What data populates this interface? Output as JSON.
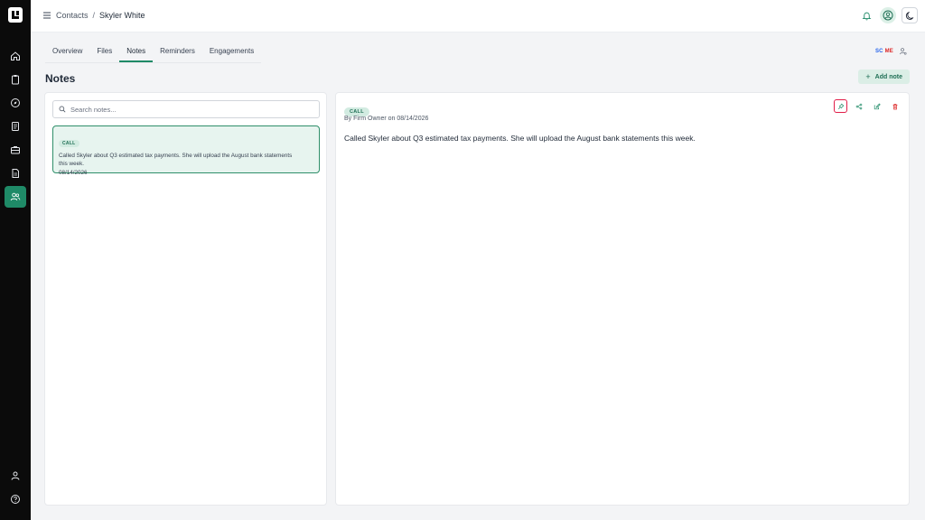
{
  "topbar": {
    "breadcrumb": [
      "Contacts",
      "/",
      "Skyler White"
    ],
    "icons": [
      "menu-icon",
      "bell-icon",
      "user-circle-icon",
      "moon-icon"
    ]
  },
  "sidebar": {
    "items": [
      {
        "icon": "home-icon"
      },
      {
        "icon": "clipboard-icon"
      },
      {
        "icon": "compass-icon"
      },
      {
        "icon": "document-list-icon"
      },
      {
        "icon": "briefcase-icon"
      },
      {
        "icon": "file-text-icon"
      },
      {
        "icon": "users-icon",
        "active": true
      }
    ],
    "bottom": [
      {
        "icon": "person-icon"
      },
      {
        "icon": "help-icon"
      }
    ]
  },
  "tabs": [
    "Overview",
    "Files",
    "Notes",
    "Reminders",
    "Engagements"
  ],
  "active_tab": "Notes",
  "tab_badge": {
    "part1": "SC",
    "part2": "ME"
  },
  "page_title": "Notes",
  "add_note_label": "Add note",
  "search": {
    "placeholder": "Search notes...",
    "value": ""
  },
  "notes_list": [
    {
      "tag": "CALL",
      "text": "Called Skyler about Q3 estimated tax payments. She will upload the August bank statements this week.",
      "date": "08/14/2026"
    }
  ],
  "detail": {
    "tag": "CALL",
    "author_line": "By Firm Owner on 08/14/2026",
    "body": "Called Skyler about Q3 estimated tax payments. She will upload the August bank statements this week.",
    "actions": [
      "pin-icon",
      "share-icon",
      "edit-icon",
      "trash-icon"
    ]
  },
  "colors": {
    "accent": "#1f8a67",
    "rail": "#0b0b0b",
    "selected_card_bg": "#e7f4ef",
    "danger": "#dc2626"
  }
}
